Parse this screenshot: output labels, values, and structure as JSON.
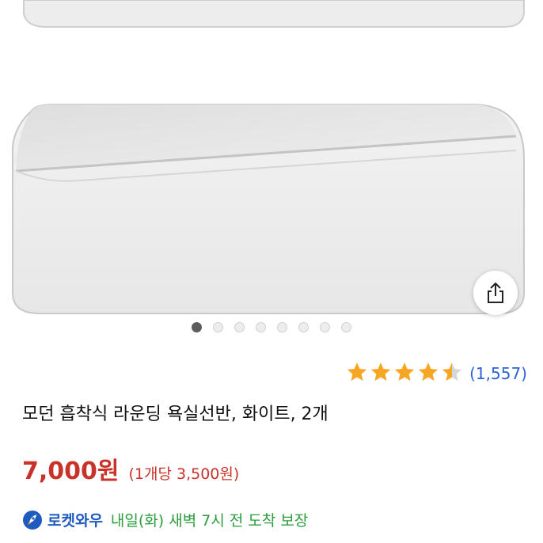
{
  "product": {
    "title": "모던 흡착식 라운딩 욕실선반, 화이트, 2개",
    "rating": 4.5,
    "rating_count": "(1,557)",
    "price": "7,000원",
    "unit_price": "(1개당 3,500원)"
  },
  "gallery": {
    "image_count": 8,
    "active_index": 0
  },
  "delivery": {
    "badge": "로켓와우",
    "text": "내일(화) 새벽 7시 전 도착 보장"
  },
  "icons": {
    "share": "share-icon",
    "rocket": "rocket-icon",
    "star": "star-icon"
  },
  "colors": {
    "price": "#c93228",
    "rating_count": "#2d62d6",
    "star": "#f6a623",
    "rocket": "#1f5bbf",
    "delivery": "#2a9d3c"
  }
}
